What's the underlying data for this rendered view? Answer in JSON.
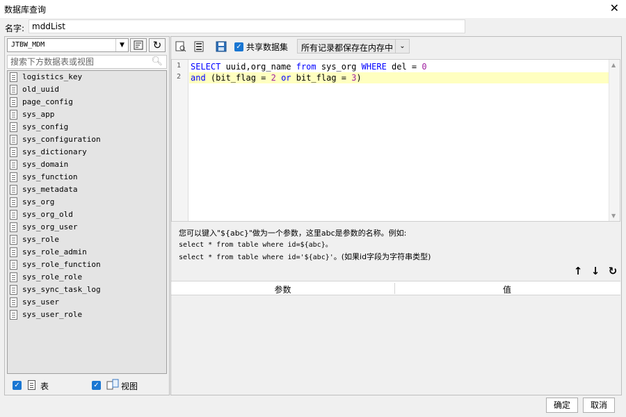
{
  "window": {
    "title": "数据库查询",
    "close_glyph": "✕"
  },
  "name_field": {
    "label": "名字:",
    "value": "mddList"
  },
  "left": {
    "db_select": "JTBW_MDM",
    "search_placeholder": "搜索下方数据表或视图",
    "tables": [
      "logistics_key",
      "old_uuid",
      "page_config",
      "sys_app",
      "sys_config",
      "sys_configuration",
      "sys_dictionary",
      "sys_domain",
      "sys_function",
      "sys_metadata",
      "sys_org",
      "sys_org_old",
      "sys_org_user",
      "sys_role",
      "sys_role_admin",
      "sys_role_function",
      "sys_role_role",
      "sys_sync_task_log",
      "sys_user",
      "sys_user_role"
    ],
    "filter_table_label": "表",
    "filter_view_label": "视图"
  },
  "right": {
    "share_label": "共享数据集",
    "cache_select": "所有记录都保存在内存中",
    "sql_lines": [
      {
        "num": "1"
      },
      {
        "num": "2"
      }
    ],
    "sql": {
      "l1_kw1": "SELECT",
      "l1_cols": " uuid,org_name ",
      "l1_kw2": "from",
      "l1_tbl": " sys_org ",
      "l1_kw3": "WHERE",
      "l1_cond": " del = ",
      "l1_num": "0",
      "l2_kw1": "and",
      "l2_p1": " (bit_flag = ",
      "l2_n1": "2",
      "l2_or": " or",
      "l2_p2": " bit_flag = ",
      "l2_n2": "3",
      "l2_end": ")"
    },
    "hint": {
      "line1": "您可以键入\"${abc}\"做为一个参数，这里abc是参数的名称。例如:",
      "line2": "select * from table where id=${abc}。",
      "line3a": "select * from table where id='${abc}'",
      "line3b": "。(如果id字段为字符串类型)"
    },
    "param_table": {
      "col_param": "参数",
      "col_value": "值"
    }
  },
  "footer": {
    "ok": "确定",
    "cancel": "取消"
  },
  "colors": {
    "checkbox": "#1976d2",
    "keyword": "#0000ff",
    "highlight_line": "#ffffc0"
  }
}
